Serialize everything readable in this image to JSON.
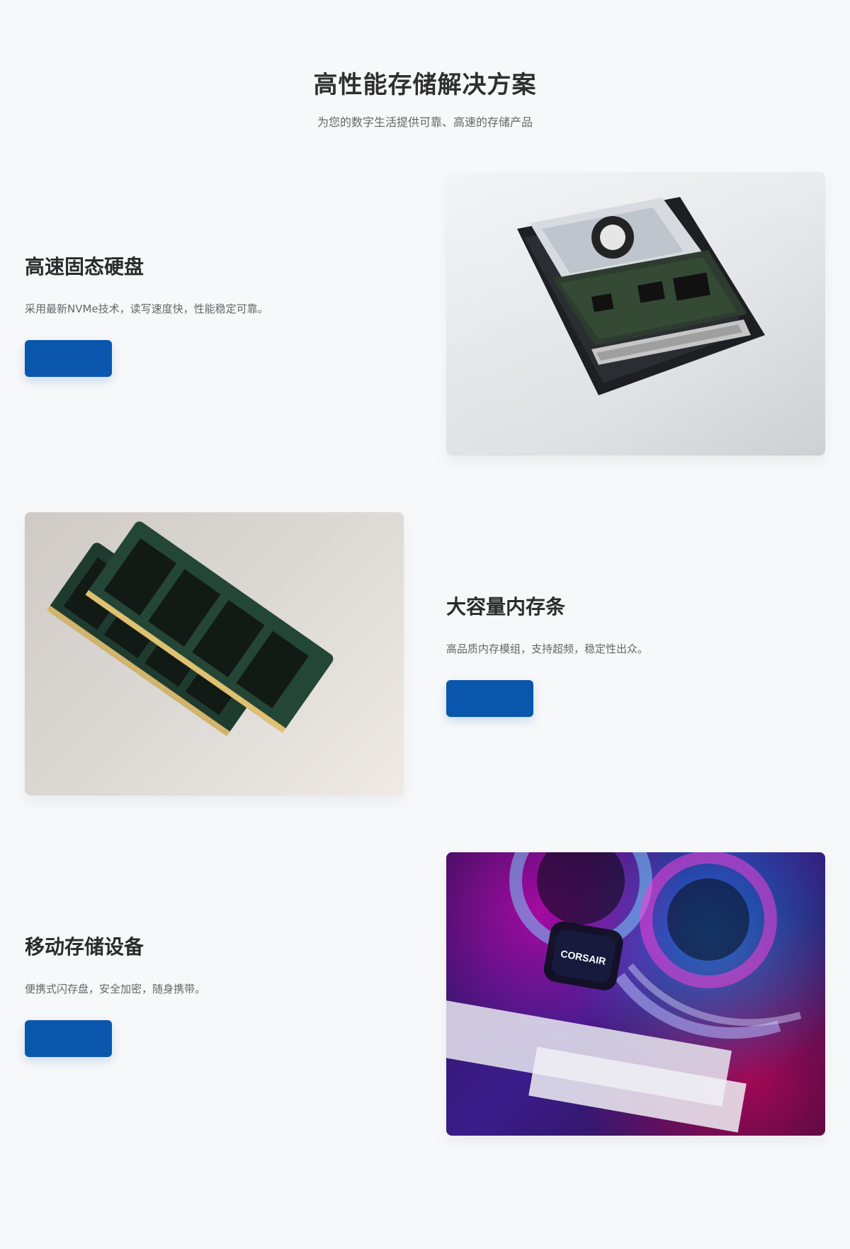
{
  "header": {
    "title": "高性能存储解决方案",
    "subtitle": "为您的数字生活提供可靠、高速的存储产品"
  },
  "features": [
    {
      "title": "高速固态硬盘",
      "description": "采用最新NVMe技术，读写速度快，性能稳定可靠。",
      "button_label": "",
      "image_logo_text": ""
    },
    {
      "title": "大容量内存条",
      "description": "高品质内存模组，支持超频，稳定性出众。",
      "button_label": "",
      "image_logo_text": ""
    },
    {
      "title": "移动存储设备",
      "description": "便携式闪存盘，安全加密，随身携带。",
      "button_label": "",
      "image_logo_text": "CORSAIR"
    }
  ],
  "colors": {
    "background": "#f7f8fa",
    "primary": "#0b56ad",
    "title": "#2f2f2f",
    "text": "#666666"
  },
  "icons": {
    "hdd": "hard-drive-image",
    "ram": "memory-module-image",
    "rgb": "rgb-pc-internals-image"
  }
}
